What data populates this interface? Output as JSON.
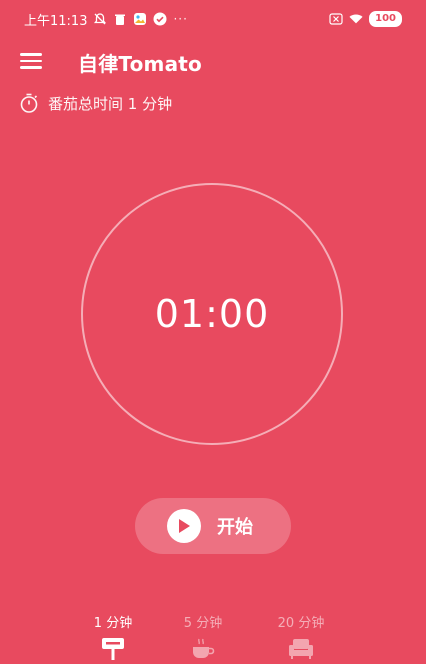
{
  "status_bar": {
    "time": "上午11:13",
    "more": "···",
    "battery": "100",
    "icons": [
      "mute-bell-icon",
      "trash-icon",
      "gallery-icon",
      "check-icon",
      "sim-icon",
      "wifi-icon",
      "battery-icon"
    ]
  },
  "app_bar": {
    "title": "自律Tomato",
    "menu_icon": "hamburger-menu-icon"
  },
  "summary": {
    "label": "番茄总时间 1 分钟",
    "icon": "stopwatch-icon"
  },
  "timer": {
    "value": "01:00"
  },
  "start_button": {
    "label": "开始",
    "icon": "play-icon"
  },
  "tabs": [
    {
      "label": "1 分钟",
      "icon": "signpost-icon",
      "active": true
    },
    {
      "label": "5 分钟",
      "icon": "coffee-cup-icon",
      "active": false
    },
    {
      "label": "20 分钟",
      "icon": "armchair-icon",
      "active": false
    }
  ],
  "colors": {
    "background": "#E84A5F",
    "foreground": "#FFFFFF"
  }
}
